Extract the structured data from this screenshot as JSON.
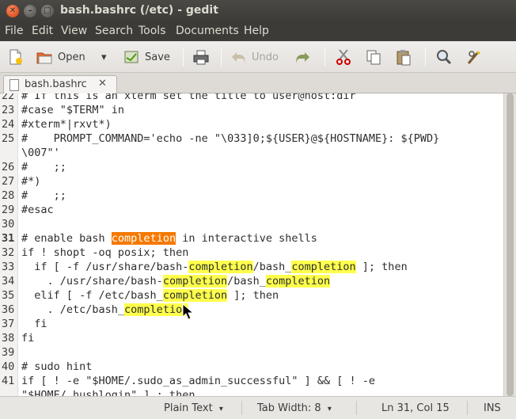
{
  "window": {
    "title": "bash.bashrc (/etc) - gedit",
    "close_glyph": "✕",
    "minimize_glyph": "–",
    "maximize_glyph": "□"
  },
  "menu": [
    "File",
    "Edit",
    "View",
    "Search",
    "Tools",
    "Documents",
    "Help"
  ],
  "toolbar": {
    "open_label": "Open",
    "open_dropdown_glyph": "▾",
    "save_label": "Save",
    "undo_label": "Undo",
    "icons": [
      "new-document-icon",
      "open-folder-icon",
      "save-icon",
      "print-icon",
      "undo-icon",
      "redo-icon",
      "cut-icon",
      "copy-icon",
      "paste-icon",
      "search-icon",
      "replace-icon"
    ]
  },
  "tab": {
    "label": "bash.bashrc",
    "close_glyph": "✕"
  },
  "editor": {
    "current_line": 31,
    "lines": [
      {
        "n": "22",
        "text": "# If this is an xterm set the title to user@host:dir"
      },
      {
        "n": "23",
        "text": "#case \"$TERM\" in"
      },
      {
        "n": "24",
        "text": "#xterm*|rxvt*)"
      },
      {
        "n": "25",
        "text": "#    PROMPT_COMMAND='echo -ne \"\\033]0;${USER}@${HOSTNAME}: ${PWD}"
      },
      {
        "n": "",
        "text": "\\007\"'"
      },
      {
        "n": "26",
        "text": "#    ;;"
      },
      {
        "n": "27",
        "text": "#*)"
      },
      {
        "n": "28",
        "text": "#    ;;"
      },
      {
        "n": "29",
        "text": "#esac"
      },
      {
        "n": "30",
        "text": ""
      },
      {
        "n": "31",
        "text": "# enable bash completion in interactive shells"
      },
      {
        "n": "32",
        "text": "if ! shopt -oq posix; then"
      },
      {
        "n": "33",
        "text": "  if [ -f /usr/share/bash-completion/bash_completion ]; then"
      },
      {
        "n": "34",
        "text": "    . /usr/share/bash-completion/bash_completion"
      },
      {
        "n": "35",
        "text": "  elif [ -f /etc/bash_completion ]; then"
      },
      {
        "n": "36",
        "text": "    . /etc/bash_completion"
      },
      {
        "n": "37",
        "text": "  fi"
      },
      {
        "n": "38",
        "text": "fi"
      },
      {
        "n": "39",
        "text": ""
      },
      {
        "n": "40",
        "text": "# sudo hint"
      },
      {
        "n": "41",
        "text": "if [ ! -e \"$HOME/.sudo_as_admin_successful\" ] && [ ! -e"
      },
      {
        "n": "",
        "text": "\"$HOME/.hushlogin\" ] ; then"
      }
    ],
    "search_term": "completion"
  },
  "colors": {
    "highlight": "#ffff4c",
    "current_match": "#f57900",
    "titlebar": "#3c3b37",
    "close_button": "#e2521e"
  },
  "status": {
    "language": "Plain Text",
    "tab_width": "Tab Width: 8",
    "position": "Ln 31, Col 15",
    "mode": "INS",
    "dropdown_glyph": "▾"
  }
}
